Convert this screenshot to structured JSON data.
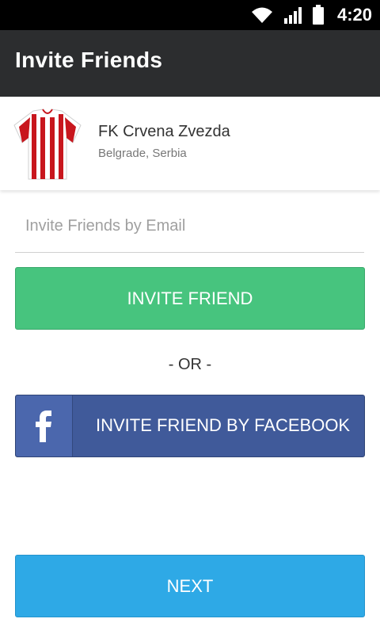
{
  "status_bar": {
    "time": "4:20"
  },
  "app_bar": {
    "title": "Invite Friends"
  },
  "team": {
    "name": "FK Crvena Zvezda",
    "location": "Belgrade, Serbia"
  },
  "email": {
    "placeholder": "Invite Friends by Email"
  },
  "buttons": {
    "invite": "INVITE FRIEND",
    "separator": "- OR -",
    "facebook": "INVITE FRIEND BY FACEBOOK",
    "next": "NEXT"
  },
  "colors": {
    "invite_green": "#47c47e",
    "facebook_blue": "#405a9a",
    "next_blue": "#2ea9e6",
    "app_bar": "#2c2d2f"
  },
  "icons": [
    "wifi-icon",
    "signal-icon",
    "battery-icon",
    "jersey-icon",
    "facebook-icon"
  ]
}
